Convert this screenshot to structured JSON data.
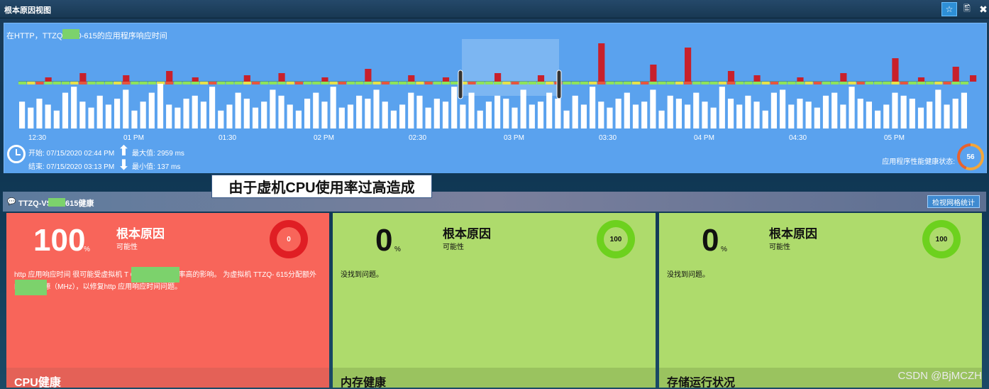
{
  "window": {
    "title": "根本原因视图",
    "buttons": {
      "favorite": "☆",
      "export": "🖺",
      "close": "✖"
    }
  },
  "chart_panel": {
    "title": "在HTTP，TTZQ-V       00-615的应用程序响应时间",
    "start_label": "开始: 07/15/2020 02:44 PM",
    "end_label": "结束: 07/15/2020 03:13 PM",
    "max_label": "最大值: 2959 ms",
    "min_label": "最小值: 137 ms",
    "health_label": "应用程序性能健康状态:",
    "health_value": "56"
  },
  "chart_data": {
    "type": "bar",
    "x_ticks": [
      "12:30",
      "01 PM",
      "01:30",
      "02 PM",
      "02:30",
      "03 PM",
      "03:30",
      "04 PM",
      "04:30",
      "05 PM"
    ],
    "selected_range": [
      "02:44 PM",
      "03:13 PM"
    ],
    "series": [
      {
        "values": [
          9,
          7,
          10,
          8,
          6,
          12,
          14,
          9,
          7,
          11,
          8,
          10,
          13,
          6,
          9,
          12,
          15,
          8,
          7,
          10,
          11,
          9,
          14,
          6,
          8,
          12,
          10,
          7,
          9,
          13,
          11,
          8,
          6,
          10,
          12,
          9,
          14,
          7,
          8,
          11,
          10,
          13,
          9,
          6,
          8,
          12,
          11,
          7,
          10,
          9,
          14,
          8,
          12,
          6,
          9,
          11,
          10,
          7,
          13,
          8,
          9,
          12,
          10,
          6,
          11,
          8,
          14,
          9,
          7,
          10,
          12,
          8,
          9,
          13,
          6,
          11,
          10,
          8,
          12,
          9,
          7,
          14,
          10,
          8,
          11,
          9,
          6,
          12,
          13,
          8,
          10,
          9,
          7,
          11,
          12,
          8,
          14,
          10,
          9,
          6,
          8,
          12,
          11,
          10,
          7,
          9,
          13,
          8,
          10,
          12
        ]
      },
      {
        "values": [
          0,
          0,
          0,
          2,
          0,
          0,
          0,
          4,
          0,
          0,
          0,
          0,
          3,
          0,
          0,
          0,
          0,
          5,
          0,
          0,
          2,
          0,
          0,
          0,
          0,
          0,
          3,
          0,
          0,
          0,
          4,
          0,
          0,
          0,
          0,
          2,
          0,
          0,
          0,
          0,
          6,
          0,
          0,
          0,
          0,
          3,
          0,
          0,
          0,
          2,
          0,
          0,
          0,
          0,
          0,
          4,
          0,
          0,
          0,
          0,
          3,
          0,
          0,
          0,
          0,
          0,
          0,
          18,
          0,
          0,
          0,
          0,
          0,
          8,
          0,
          0,
          0,
          16,
          0,
          0,
          0,
          0,
          5,
          0,
          0,
          3,
          0,
          0,
          0,
          0,
          2,
          0,
          0,
          0,
          0,
          4,
          0,
          0,
          0,
          0,
          0,
          11,
          0,
          0,
          2,
          0,
          0,
          0,
          7,
          0,
          3
        ]
      }
    ]
  },
  "health_section": {
    "title": "TTZQ-VS      00-615健康",
    "button": "检视网格统计",
    "callout": "由于虚机CPU使用率过高造成"
  },
  "cards": [
    {
      "value": "100",
      "unit": "%",
      "title": "根本原因",
      "subtitle": "可能性",
      "ring_value": "0",
      "description": "http 应用响应时间 很可能受虚拟机 T            615上CPU使用率高的影响。 为虚拟机 TTZQ-              615分配额外的CPU资源（MHz），以修复http 应用响应时间问题。",
      "footer": "CPU健康"
    },
    {
      "value": "0",
      "unit": "%",
      "title": "根本原因",
      "subtitle": "可能性",
      "ring_value": "100",
      "description": "没找到问题。",
      "footer": "内存健康"
    },
    {
      "value": "0",
      "unit": "%",
      "title": "根本原因",
      "subtitle": "可能性",
      "ring_value": "100",
      "description": "没找到问题。",
      "footer": "存储运行状况"
    }
  ],
  "watermark": "CSDN @BjMCZH",
  "colors": {
    "chart_bg": "#5aa2ee",
    "red_card": "#f8655a",
    "green_card": "#aedb6c",
    "ring_red": "#e01e24",
    "ring_green": "#6dd11e",
    "health_ring": "#f3a63a"
  }
}
